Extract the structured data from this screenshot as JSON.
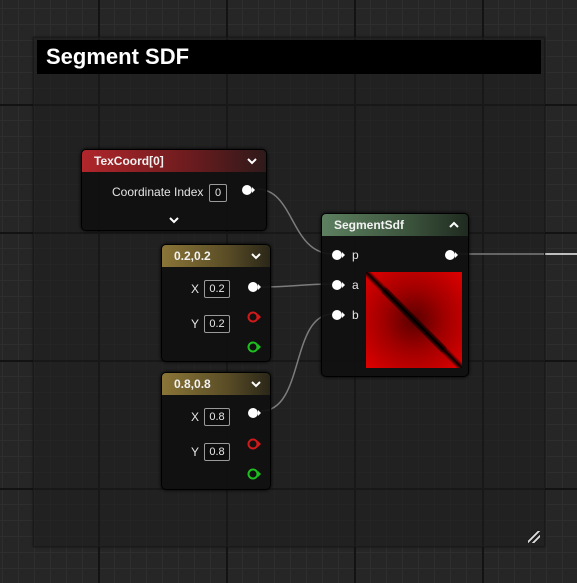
{
  "comment": {
    "title": "Segment SDF"
  },
  "texcoord_node": {
    "title": "TexCoord[0]",
    "coordinate_index_label": "Coordinate Index",
    "coordinate_index_value": "0"
  },
  "const_a_node": {
    "title": "0.2,0.2",
    "x_label": "X",
    "x_value": "0.2",
    "y_label": "Y",
    "y_value": "0.2"
  },
  "const_b_node": {
    "title": "0.8,0.8",
    "x_label": "X",
    "x_value": "0.8",
    "y_label": "Y",
    "y_value": "0.8"
  },
  "segment_node": {
    "title": "SegmentSdf",
    "input_p": "p",
    "input_a": "a",
    "input_b": "b"
  },
  "colors": {
    "texcoord_header": "#b0262b",
    "constant_header": "#8a7537",
    "function_header": "#5d8060",
    "pin_white": "#ffffff",
    "pin_red": "#d01a1a",
    "pin_green": "#1fbf1f",
    "wire": "#f0f0f0"
  },
  "icons": [
    "chevron-down-icon",
    "chevron-up-icon",
    "resize-grip-icon",
    "float-pin-icon"
  ]
}
